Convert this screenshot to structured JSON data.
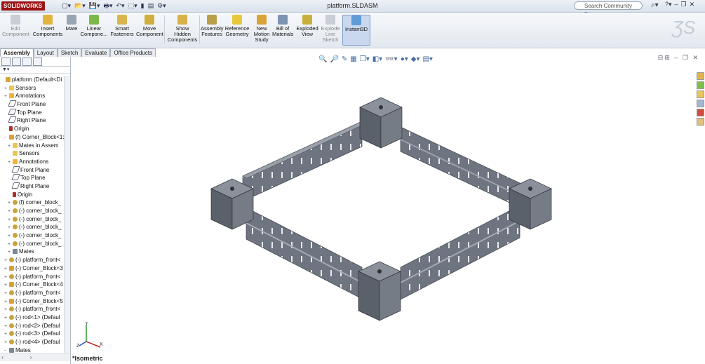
{
  "app": {
    "logo": "SOLIDWORKS",
    "document_title": "platform.SLDASM"
  },
  "search": {
    "placeholder": "Search Community Forum"
  },
  "ribbon": {
    "buttons": [
      {
        "label": "Edit Component"
      },
      {
        "label": "Insert Components"
      },
      {
        "label": "Mate"
      },
      {
        "label": "Linear Compone..."
      },
      {
        "label": "Smart Fasteners"
      },
      {
        "label": "Move Component"
      },
      {
        "label": "Show Hidden Components"
      },
      {
        "label": "Assembly Features"
      },
      {
        "label": "Reference Geometry"
      },
      {
        "label": "New Motion Study"
      },
      {
        "label": "Bill of Materials"
      },
      {
        "label": "Exploded View"
      },
      {
        "label": "Explode Line Sketch"
      },
      {
        "label": "Instant3D"
      }
    ]
  },
  "tabs": [
    "Assembly",
    "Layout",
    "Sketch",
    "Evaluate",
    "Office Products"
  ],
  "tree": [
    {
      "label": "platform  (Default<Di",
      "icon": "asm",
      "toggle": ""
    },
    {
      "label": "Sensors",
      "icon": "folder",
      "toggle": "+"
    },
    {
      "label": "Annotations",
      "icon": "anno",
      "toggle": "+"
    },
    {
      "label": "Front Plane",
      "icon": "plane",
      "toggle": ""
    },
    {
      "label": "Top Plane",
      "icon": "plane",
      "toggle": ""
    },
    {
      "label": "Right Plane",
      "icon": "plane",
      "toggle": ""
    },
    {
      "label": "Origin",
      "icon": "origin",
      "toggle": ""
    },
    {
      "label": "(f) Corner_Block<1:",
      "icon": "asm",
      "toggle": "-"
    },
    {
      "label": "Mates in Assem",
      "icon": "folder",
      "toggle": "+"
    },
    {
      "label": "Sensors",
      "icon": "folder",
      "toggle": ""
    },
    {
      "label": "Annotations",
      "icon": "anno",
      "toggle": "+"
    },
    {
      "label": "Front Plane",
      "icon": "plane",
      "toggle": ""
    },
    {
      "label": "Top Plane",
      "icon": "plane",
      "toggle": ""
    },
    {
      "label": "Right Plane",
      "icon": "plane",
      "toggle": ""
    },
    {
      "label": "Origin",
      "icon": "origin",
      "toggle": ""
    },
    {
      "label": "(f) corner_block_",
      "icon": "part",
      "toggle": "+"
    },
    {
      "label": "(-) corner_block_",
      "icon": "part",
      "toggle": "+"
    },
    {
      "label": "(-) corner_block_",
      "icon": "part",
      "toggle": "+"
    },
    {
      "label": "(-) corner_block_",
      "icon": "part",
      "toggle": "+"
    },
    {
      "label": "(-) corner_block_",
      "icon": "part",
      "toggle": "+"
    },
    {
      "label": "(-) corner_block_",
      "icon": "part",
      "toggle": "+"
    },
    {
      "label": "Mates",
      "icon": "mates",
      "toggle": "+"
    },
    {
      "label": "(-) platform_front<",
      "icon": "part",
      "toggle": "+"
    },
    {
      "label": "(-) Corner_Block<3",
      "icon": "asm",
      "toggle": "+"
    },
    {
      "label": "(-) platform_front<",
      "icon": "part",
      "toggle": "+"
    },
    {
      "label": "(-) Corner_Block<4",
      "icon": "asm",
      "toggle": "+"
    },
    {
      "label": "(-) platform_front<",
      "icon": "part",
      "toggle": "+"
    },
    {
      "label": "(-) Corner_Block<5",
      "icon": "asm",
      "toggle": "+"
    },
    {
      "label": "(-) platform_front<",
      "icon": "part",
      "toggle": "+"
    },
    {
      "label": "(-) rod<1> (Defaul",
      "icon": "part",
      "toggle": "+"
    },
    {
      "label": "(-) rod<2> (Defaul",
      "icon": "part",
      "toggle": "+"
    },
    {
      "label": "(-) rod<3> (Defaul",
      "icon": "part",
      "toggle": "+"
    },
    {
      "label": "(-) rod<4> (Defaul",
      "icon": "part",
      "toggle": "+"
    },
    {
      "label": "Mates",
      "icon": "mates",
      "toggle": "-"
    }
  ],
  "viewport": {
    "view_label": "*Isometric",
    "triad": {
      "x": "X",
      "y": "Y",
      "z": "Z"
    }
  },
  "colors": {
    "accent": "#9b1313",
    "part_gray": "#6e7480"
  }
}
